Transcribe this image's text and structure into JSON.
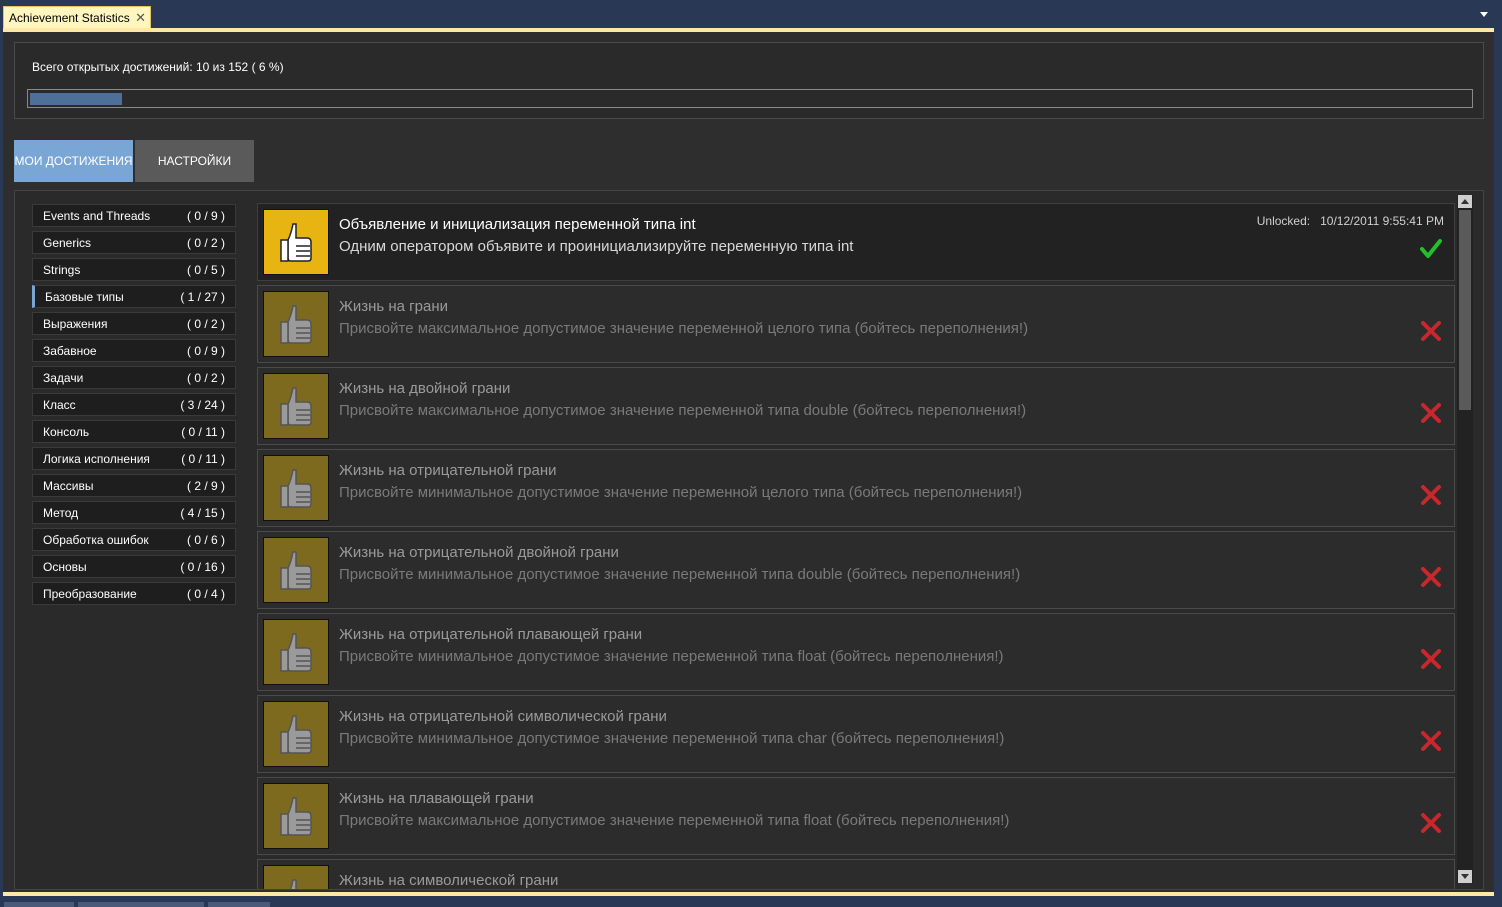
{
  "document_tab": {
    "title": "Achievement Statistics",
    "close": "✕"
  },
  "summary": {
    "text": "Всего открытых достижений: 10 из 152 ( 6 %)",
    "unlocked": 10,
    "total": 152,
    "progress": 0.064
  },
  "view_tabs": [
    {
      "label": "Мои достижения",
      "active": true
    },
    {
      "label": "Настройки",
      "active": false
    }
  ],
  "categories": [
    {
      "name": "Events and Threads",
      "count": "( 0 / 9 )"
    },
    {
      "name": "Generics",
      "count": "( 0 / 2 )"
    },
    {
      "name": "Strings",
      "count": "( 0 / 5 )"
    },
    {
      "name": "Базовые типы",
      "count": "( 1 / 27 )",
      "selected": true
    },
    {
      "name": "Выражения",
      "count": "( 0 / 2 )"
    },
    {
      "name": "Забавное",
      "count": "( 0 / 9 )"
    },
    {
      "name": "Задачи",
      "count": "( 0 / 2 )"
    },
    {
      "name": "Класс",
      "count": "( 3 / 24 )"
    },
    {
      "name": "Консоль",
      "count": "( 0 / 11 )"
    },
    {
      "name": "Логика исполнения",
      "count": "( 0 / 11 )"
    },
    {
      "name": "Массивы",
      "count": "( 2 / 9 )"
    },
    {
      "name": "Метод",
      "count": "( 4 / 15 )"
    },
    {
      "name": "Обработка ошибок",
      "count": "( 0 / 6 )"
    },
    {
      "name": "Основы",
      "count": "( 0 / 16 )"
    },
    {
      "name": "Преобразование",
      "count": "( 0 / 4 )"
    }
  ],
  "achievements": [
    {
      "title": "Объявление и инициализация переменной типа int",
      "desc": "Одним оператором объявите и проинициализируйте переменную типа int",
      "unlocked": true,
      "unlocked_label": "Unlocked:   10/12/2011 9:55:41 PM"
    },
    {
      "title": "Жизнь на грани",
      "desc": "Присвойте максимальное допустимое значение переменной целого типа (бойтесь переполнения!)",
      "unlocked": false
    },
    {
      "title": "Жизнь на двойной грани",
      "desc": "Присвойте максимальное допустимое значение переменной типа double (бойтесь переполнения!)",
      "unlocked": false
    },
    {
      "title": "Жизнь на отрицательной грани",
      "desc": "Присвойте минимальное допустимое значение переменной целого типа (бойтесь переполнения!)",
      "unlocked": false
    },
    {
      "title": "Жизнь на отрицательной двойной грани",
      "desc": "Присвойте минимальное допустимое значение переменной типа double (бойтесь переполнения!)",
      "unlocked": false
    },
    {
      "title": "Жизнь на отрицательной плавающей грани",
      "desc": "Присвойте минимальное допустимое значение переменной типа float (бойтесь переполнения!)",
      "unlocked": false
    },
    {
      "title": "Жизнь на отрицательной символической грани",
      "desc": "Присвойте минимальное допустимое значение переменной типа char (бойтесь переполнения!)",
      "unlocked": false
    },
    {
      "title": "Жизнь на плавающей грани",
      "desc": "Присвойте максимальное допустимое значение переменной типа float (бойтесь переполнения!)",
      "unlocked": false
    },
    {
      "title": "Жизнь на символической грани",
      "desc": "",
      "unlocked": false
    }
  ],
  "colors": {
    "accent": "#7aa6d6",
    "unlocked_icon": "#e7b411",
    "locked_icon": "#7d6a1e",
    "check": "#22c02a",
    "cross": "#c8282c"
  },
  "icons": {
    "achievement": "thumbs-up-icon",
    "unlocked_status": "checkmark-icon",
    "locked_status": "cross-icon"
  }
}
